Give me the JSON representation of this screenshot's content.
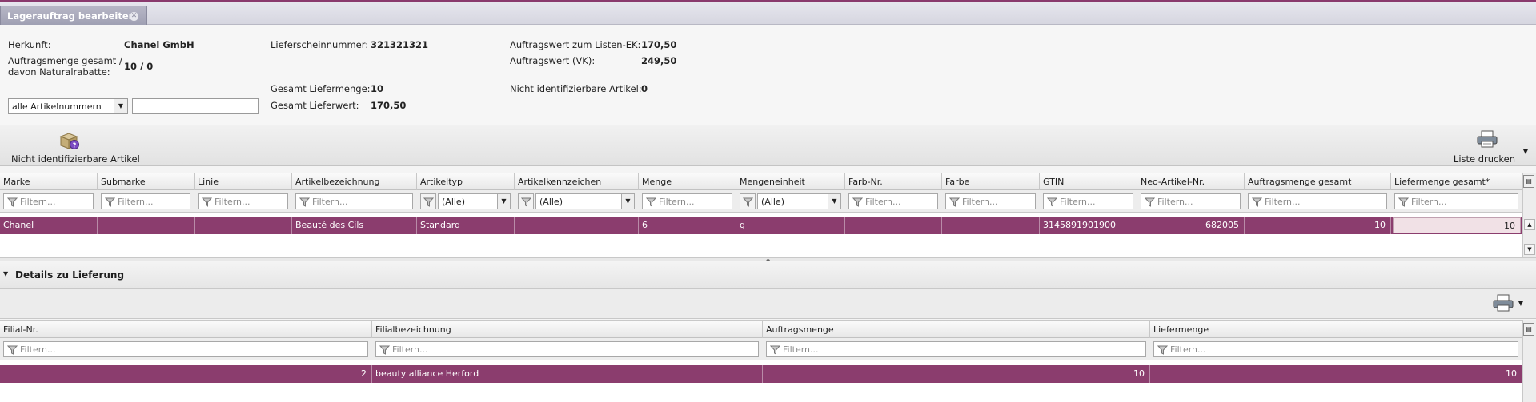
{
  "tab": {
    "title": "Lagerauftrag bearbeiten"
  },
  "info": {
    "herkunft_label": "Herkunft:",
    "herkunft_value": "Chanel GmbH",
    "auftragsmenge_label_1": "Auftragsmenge gesamt /",
    "auftragsmenge_label_2": "davon Naturalrabatte:",
    "auftragsmenge_value": "10 / 0",
    "lieferschein_label": "Lieferscheinnummer:",
    "lieferschein_value": "321321321",
    "gesamt_liefermenge_label": "Gesamt Liefermenge:",
    "gesamt_liefermenge_value": "10",
    "gesamt_lieferwert_label": "Gesamt Lieferwert:",
    "gesamt_lieferwert_value": "170,50",
    "auftragswert_ek_label": "Auftragswert zum Listen-EK:",
    "auftragswert_ek_value": "170,50",
    "auftragswert_vk_label": "Auftragswert (VK):",
    "auftragswert_vk_value": "249,50",
    "nicht_ident_label": "Nicht identifizierbare Artikel:",
    "nicht_ident_value": "0",
    "artikel_combo": "alle Artikelnummern",
    "artikel_input": ""
  },
  "toolbar": {
    "nicht_ident_button": "Nicht identifizierbare Artikel",
    "print_button": "Liste drucken"
  },
  "articles": {
    "columns": [
      "Marke",
      "Submarke",
      "Linie",
      "Artikelbezeichnung",
      "Artikeltyp",
      "Artikelkennzeichen",
      "Menge",
      "Mengeneinheit",
      "Farb-Nr.",
      "Farbe",
      "GTIN",
      "Neo-Artikel-Nr.",
      "Auftragsmenge gesamt",
      "Liefermenge gesamt*"
    ],
    "filter_placeholder": "Filtern...",
    "select_all": "(Alle)",
    "rows": [
      [
        "Chanel",
        "",
        "",
        "Beauté des Cils",
        "Standard",
        "",
        "6",
        "g",
        "",
        "",
        "3145891901900",
        "682005",
        "10",
        "10"
      ]
    ]
  },
  "details": {
    "section_title": "Details zu Lieferung",
    "columns": [
      "Filial-Nr.",
      "Filialbezeichnung",
      "Auftragsmenge",
      "Liefermenge"
    ],
    "filter_placeholder": "Filtern...",
    "rows": [
      [
        "2",
        "beauty alliance Herford",
        "10",
        "10"
      ]
    ]
  },
  "colors": {
    "accent": "#8b3d6e",
    "tab": "#a3a4b8"
  },
  "icons": [
    "close-icon",
    "package-question-icon",
    "printer-icon",
    "filter-icon",
    "column-chooser-icon",
    "collapse-caret-icon"
  ]
}
